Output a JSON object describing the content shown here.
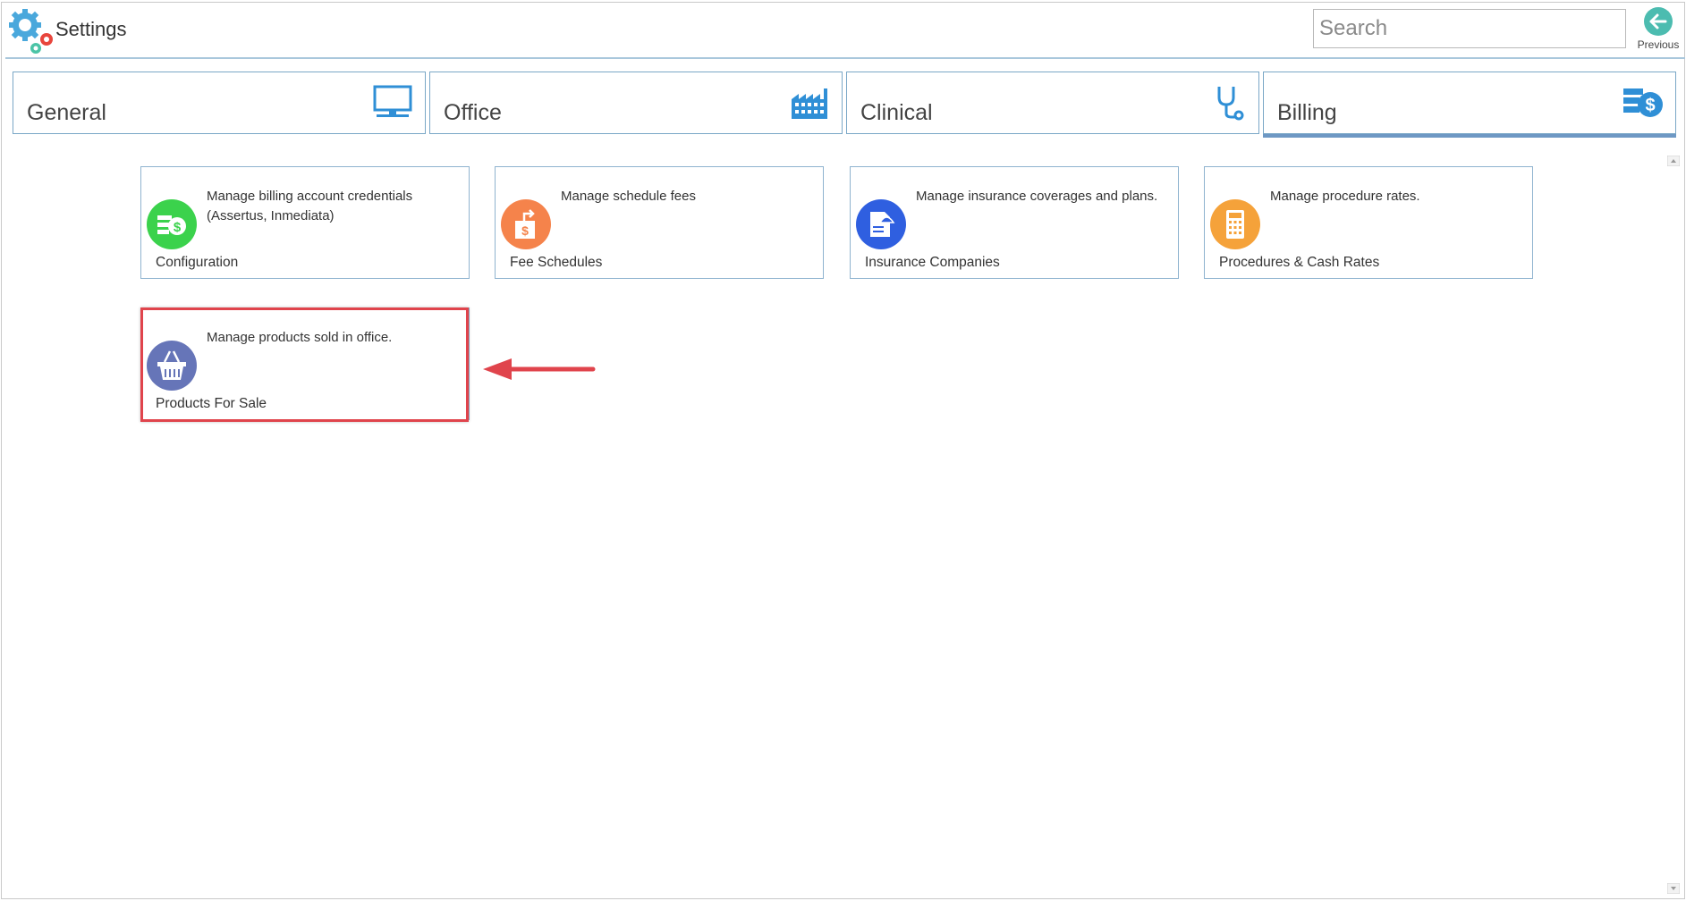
{
  "app": {
    "title": "Settings"
  },
  "search": {
    "placeholder": "Search",
    "value": ""
  },
  "previous": {
    "label": "Previous"
  },
  "tabs": [
    {
      "label": "General",
      "icon": "monitor-icon"
    },
    {
      "label": "Office",
      "icon": "factory-icon"
    },
    {
      "label": "Clinical",
      "icon": "stethoscope-icon"
    },
    {
      "label": "Billing",
      "icon": "billing-dollar-icon",
      "active": true
    }
  ],
  "cards": [
    {
      "title": "Configuration",
      "description": "Manage billing account credentials (Assertus, Inmediata)",
      "icon": "money-stack-icon",
      "color": "#3bd24c"
    },
    {
      "title": "Fee Schedules",
      "description": "Manage schedule fees",
      "icon": "price-tag-icon",
      "color": "#f5834b"
    },
    {
      "title": "Insurance Companies",
      "description": "Manage insurance coverages and plans.",
      "icon": "insurance-document-icon",
      "color": "#2f5fe0"
    },
    {
      "title": "Procedures & Cash Rates",
      "description": "Manage procedure rates.",
      "icon": "calculator-icon",
      "color": "#f5a23a"
    },
    {
      "title": "Products For Sale",
      "description": "Manage products sold in office.",
      "icon": "basket-icon",
      "color": "#6675b8"
    }
  ],
  "colors": {
    "accent": "#6e98c4",
    "highlight": "#e0444c",
    "tab_border": "#7aa7c7"
  }
}
